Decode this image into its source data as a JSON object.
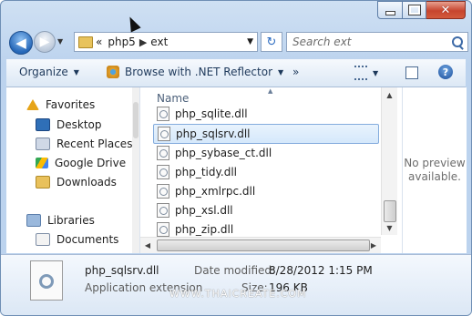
{
  "window": {
    "minimize_icon": "minimize-icon",
    "maximize_icon": "maximize-icon",
    "close_icon": "close-icon",
    "close_glyph": "✕"
  },
  "nav": {
    "back_glyph": "◀",
    "forward_glyph": "▶",
    "recent_glyph": "▼",
    "breadcrumb_overflow": "«",
    "breadcrumb": [
      "php5",
      "ext"
    ],
    "separator": "▶",
    "dropdown_glyph": "▼",
    "refresh_glyph": "↻",
    "search_placeholder": "Search ext"
  },
  "toolbar": {
    "organize": "Organize",
    "browse": "Browse with .NET Reflector",
    "more": "»",
    "arrow": "▼",
    "help": "?"
  },
  "sidebar": {
    "items": [
      {
        "label": "Favorites",
        "icon": "star-icon"
      },
      {
        "label": "Desktop",
        "icon": "desktop-icon"
      },
      {
        "label": "Recent Places",
        "icon": "recent-places-icon"
      },
      {
        "label": "Google Drive",
        "icon": "google-drive-icon"
      },
      {
        "label": "Downloads",
        "icon": "downloads-icon"
      },
      {
        "label": "Libraries",
        "icon": "libraries-icon"
      },
      {
        "label": "Documents",
        "icon": "documents-icon"
      }
    ]
  },
  "files": {
    "column_header": "Name",
    "sort_glyph": "▲",
    "items": [
      {
        "name": "php_sqlite.dll",
        "selected": false
      },
      {
        "name": "php_sqlsrv.dll",
        "selected": true
      },
      {
        "name": "php_sybase_ct.dll",
        "selected": false
      },
      {
        "name": "php_tidy.dll",
        "selected": false
      },
      {
        "name": "php_xmlrpc.dll",
        "selected": false
      },
      {
        "name": "php_xsl.dll",
        "selected": false
      },
      {
        "name": "php_zip.dll",
        "selected": false
      }
    ],
    "scroll_up": "▲",
    "scroll_down": "▼",
    "scroll_left": "◀",
    "scroll_right": "▶"
  },
  "preview": {
    "line1": "No preview",
    "line2": "available."
  },
  "details": {
    "file_name": "php_sqlsrv.dll",
    "file_type": "Application extension",
    "date_label": "Date modified:",
    "date_value": "8/28/2012 1:15 PM",
    "size_label": "Size:",
    "size_value": "196 KB"
  },
  "watermark": "WWW.THAICREATE.COM"
}
